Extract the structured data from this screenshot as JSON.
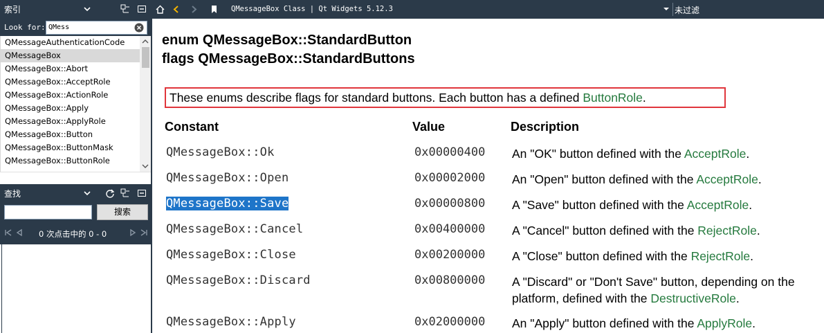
{
  "index_panel": {
    "title": "索引",
    "look_for_label": "Look for:",
    "look_for_value": "QMess",
    "items": [
      "QMessageAuthenticationCode",
      "QMessageBox",
      "QMessageBox::Abort",
      "QMessageBox::AcceptRole",
      "QMessageBox::ActionRole",
      "QMessageBox::Apply",
      "QMessageBox::ApplyRole",
      "QMessageBox::Button",
      "QMessageBox::ButtonMask",
      "QMessageBox::ButtonRole"
    ],
    "selected_index": 1
  },
  "search_panel": {
    "title": "查找",
    "input_value": "",
    "search_button": "搜索",
    "pager_text": "0 次点击中的 0 - 0"
  },
  "toolbar": {
    "doc_title": "QMessageBox Class | Qt Widgets 5.12.3",
    "filter_text": "未过滤"
  },
  "content": {
    "heading1": "enum QMessageBox::StandardButton",
    "heading2": "flags QMessageBox::StandardButtons",
    "intro_prefix": "These enums describe flags for standard buttons. Each button has a defined ",
    "intro_link": "ButtonRole",
    "intro_suffix": ".",
    "col_constant": "Constant",
    "col_value": "Value",
    "col_description": "Description",
    "rows": [
      {
        "constant": "QMessageBox::Ok",
        "value": "0x00000400",
        "desc_prefix": "An \"OK\" button defined with the ",
        "desc_link": "AcceptRole",
        "desc_suffix": "."
      },
      {
        "constant": "QMessageBox::Open",
        "value": "0x00002000",
        "desc_prefix": "An \"Open\" button defined with the ",
        "desc_link": "AcceptRole",
        "desc_suffix": "."
      },
      {
        "constant": "QMessageBox::Save",
        "value": "0x00000800",
        "desc_prefix": "A \"Save\" button defined with the ",
        "desc_link": "AcceptRole",
        "desc_suffix": "."
      },
      {
        "constant": "QMessageBox::Cancel",
        "value": "0x00400000",
        "desc_prefix": "A \"Cancel\" button defined with the ",
        "desc_link": "RejectRole",
        "desc_suffix": "."
      },
      {
        "constant": "QMessageBox::Close",
        "value": "0x00200000",
        "desc_prefix": "A \"Close\" button defined with the ",
        "desc_link": "RejectRole",
        "desc_suffix": "."
      },
      {
        "constant": "QMessageBox::Discard",
        "value": "0x00800000",
        "desc_prefix": "A \"Discard\" or \"Don't Save\" button, depending on the platform, defined with the ",
        "desc_link": "DestructiveRole",
        "desc_suffix": "."
      },
      {
        "constant": "QMessageBox::Apply",
        "value": "0x02000000",
        "desc_prefix": "An \"Apply\" button defined with the ",
        "desc_link": "ApplyRole",
        "desc_suffix": "."
      }
    ],
    "highlighted_row": 2
  },
  "colors": {
    "panel_dark": "#2b3a49",
    "link_green": "#257a3e",
    "highlight_red": "#e0353b",
    "selection_blue": "#1e75c9"
  },
  "icons": [
    "chevron-down-icon",
    "collapse-all-icon",
    "close-panel-icon",
    "clear-icon",
    "sync-icon",
    "home-icon",
    "back-icon",
    "forward-icon",
    "bookmark-icon",
    "first-page-icon",
    "prev-page-icon",
    "next-page-icon",
    "last-page-icon"
  ]
}
